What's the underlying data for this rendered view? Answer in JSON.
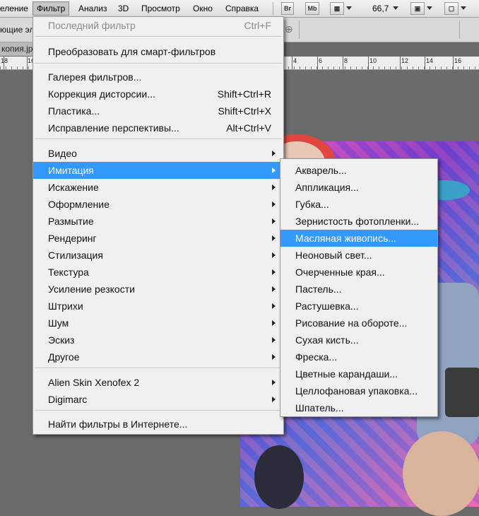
{
  "menubar": {
    "items": [
      "еление",
      "Фильтр",
      "Анализ",
      "3D",
      "Просмотр",
      "Окно",
      "Справка"
    ],
    "bridge_btn": "Br",
    "minibridge_btn": "Mb",
    "zoom": "66,7"
  },
  "options": {
    "label": "ющие эл"
  },
  "document": {
    "tab": "копия.jp"
  },
  "ruler": {
    "labels": [
      "18",
      "16",
      "4",
      "6",
      "8",
      "10",
      "12",
      "14",
      "16"
    ]
  },
  "filter_menu": {
    "items": [
      {
        "label": "Последний фильтр",
        "shortcut": "Ctrl+F"
      },
      {
        "label": "Преобразовать для смарт-фильтров"
      },
      {
        "label": "Галерея фильтров..."
      },
      {
        "label": "Коррекция дисторсии...",
        "shortcut": "Shift+Ctrl+R"
      },
      {
        "label": "Пластика...",
        "shortcut": "Shift+Ctrl+X"
      },
      {
        "label": "Исправление перспективы...",
        "shortcut": "Alt+Ctrl+V"
      },
      {
        "label": "Видео"
      },
      {
        "label": "Имитация"
      },
      {
        "label": "Искажение"
      },
      {
        "label": "Оформление"
      },
      {
        "label": "Размытие"
      },
      {
        "label": "Рендеринг"
      },
      {
        "label": "Стилизация"
      },
      {
        "label": "Текстура"
      },
      {
        "label": "Усиление резкости"
      },
      {
        "label": "Штрихи"
      },
      {
        "label": "Шум"
      },
      {
        "label": "Эскиз"
      },
      {
        "label": "Другое"
      },
      {
        "label": "Alien Skin Xenofex 2"
      },
      {
        "label": "Digimarc"
      },
      {
        "label": "Найти фильтры в Интернете..."
      }
    ]
  },
  "artistic_submenu": {
    "items": [
      "Акварель...",
      "Аппликация...",
      "Губка...",
      "Зернистость фотопленки...",
      "Масляная живопись...",
      "Неоновый свет...",
      "Очерченные края...",
      "Пастель...",
      "Растушевка...",
      "Рисование на обороте...",
      "Сухая кисть...",
      "Фреска...",
      "Цветные карандаши...",
      "Целлофановая упаковка...",
      "Шпатель..."
    ]
  }
}
